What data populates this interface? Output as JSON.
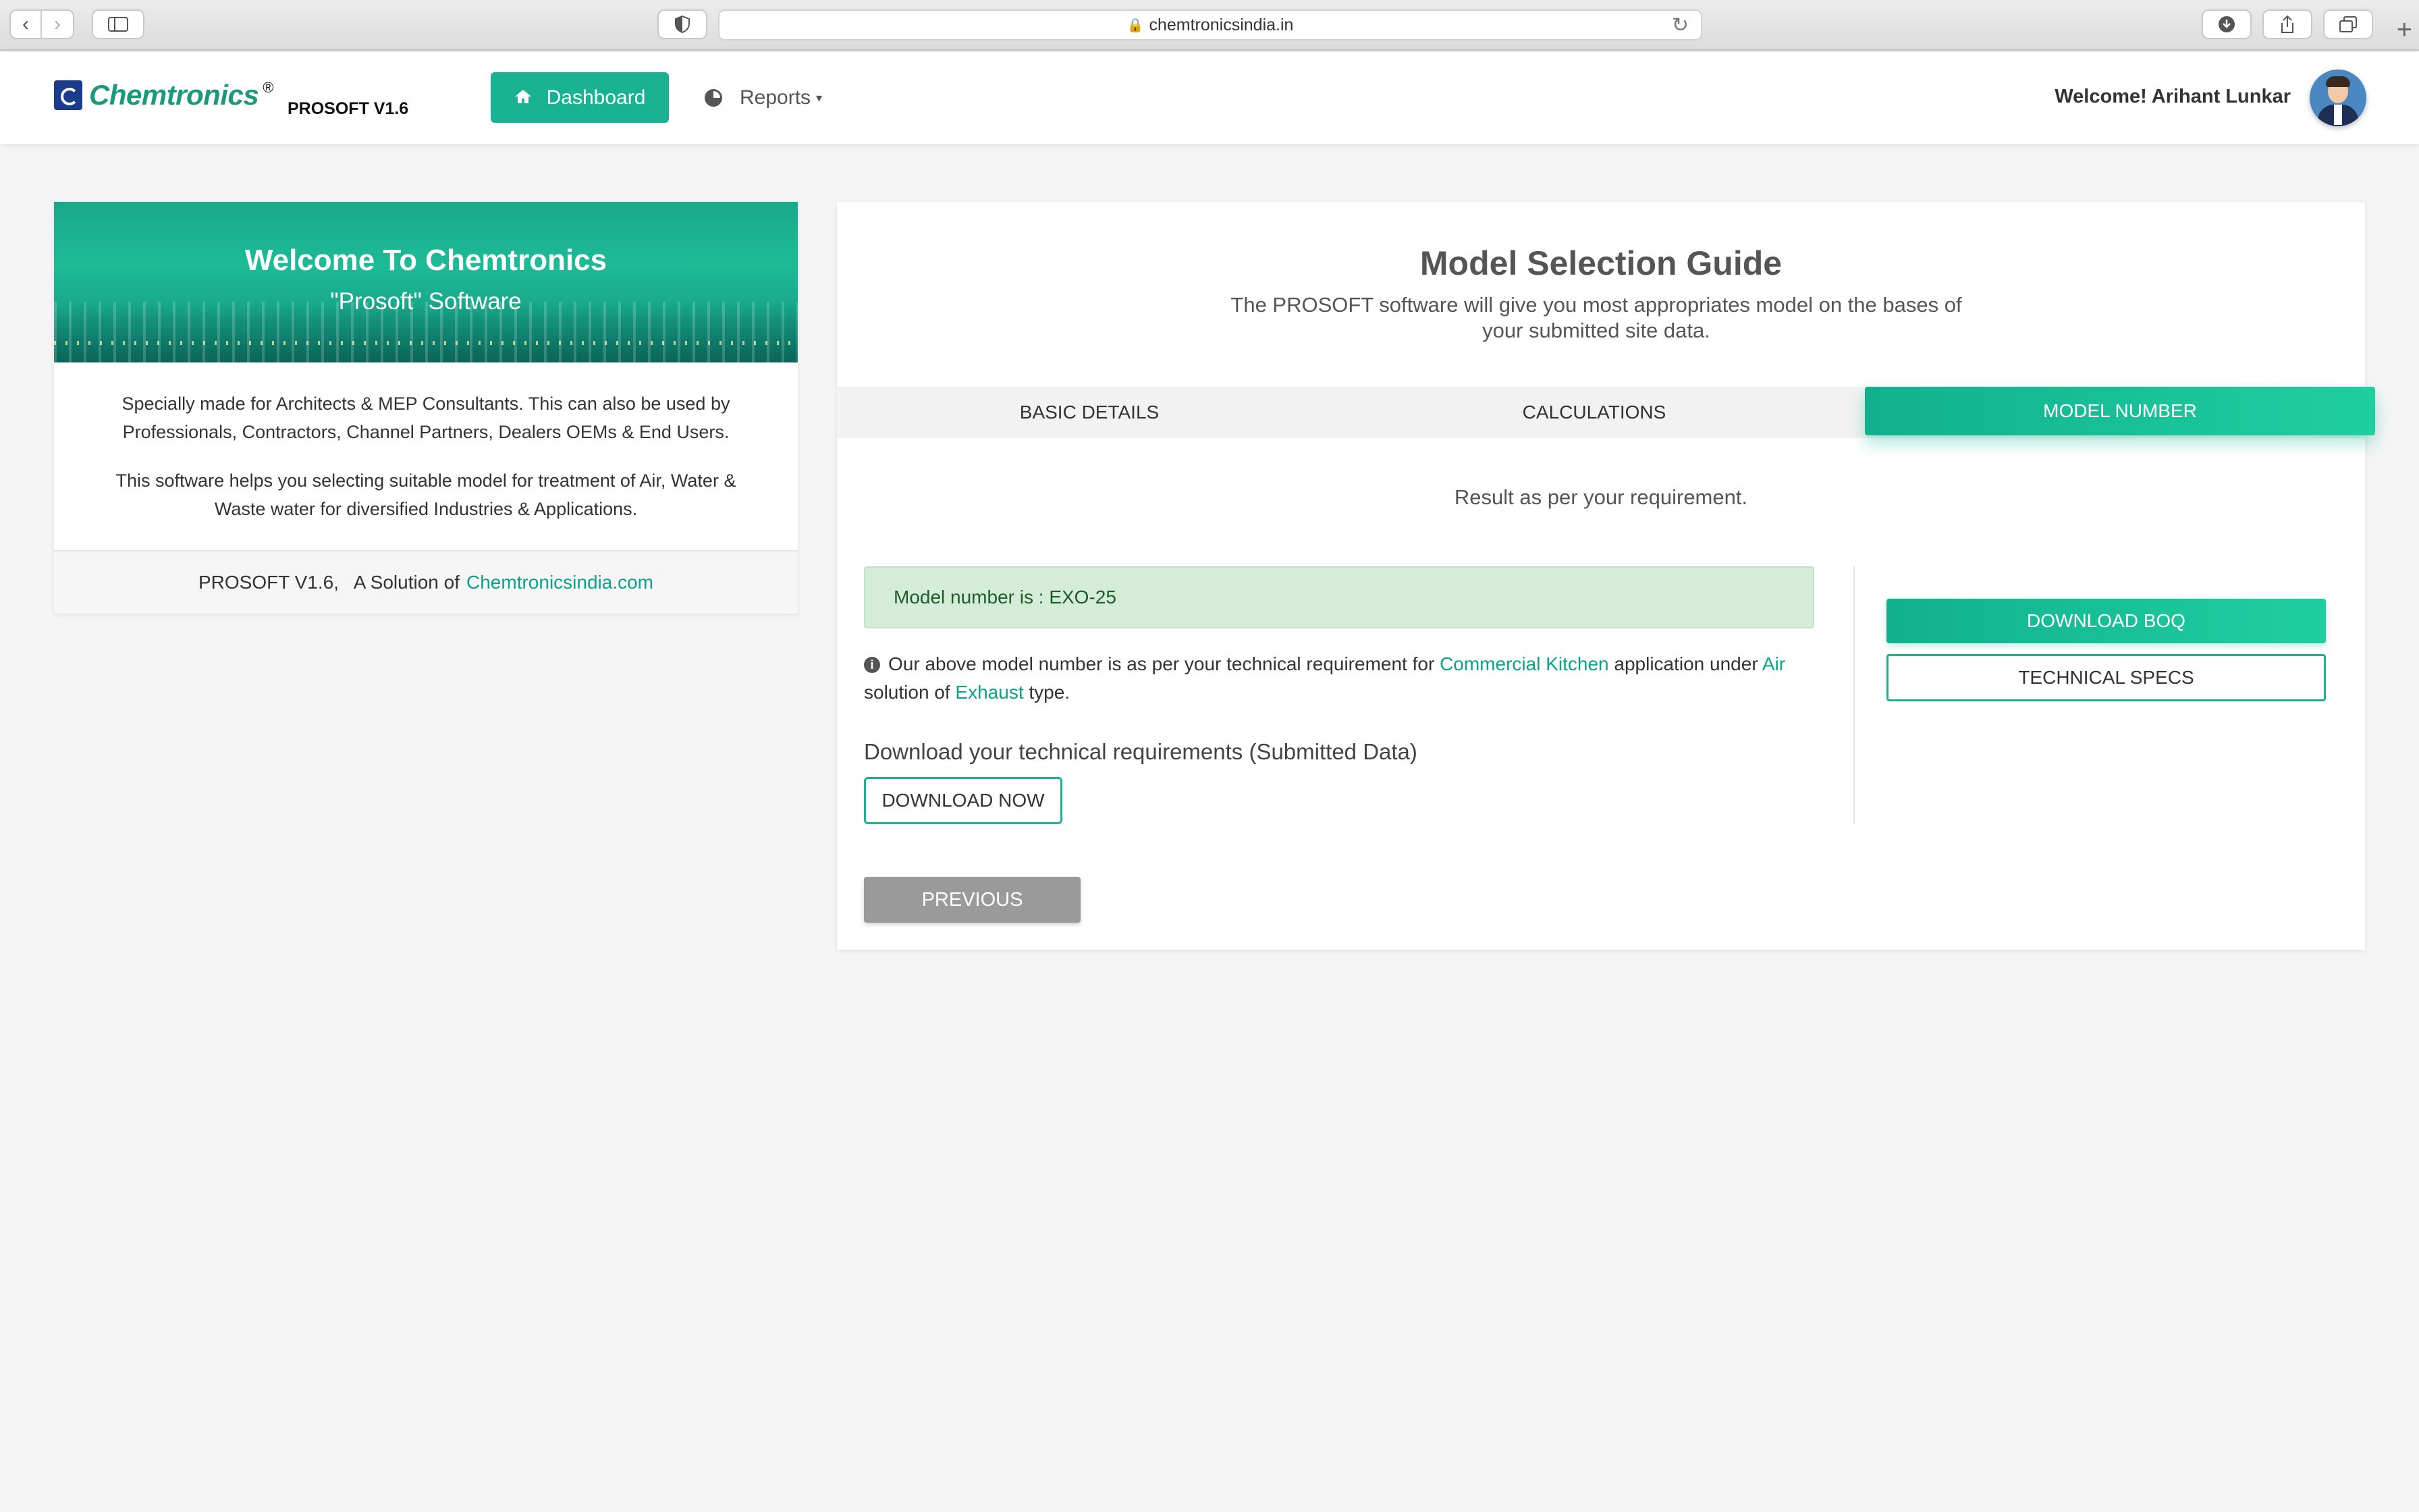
{
  "browser": {
    "url": "chemtronicsindia.in",
    "back_icon": "chevron-left",
    "forward_icon": "chevron-right",
    "new_tab_symbol": "+"
  },
  "header": {
    "brand": "Chemtronics",
    "registered": "®",
    "version": "PROSOFT V1.6",
    "dashboard_label": "Dashboard",
    "reports_label": "Reports",
    "welcome_text": "Welcome! Arihant Lunkar"
  },
  "welcome_card": {
    "title": "Welcome To Chemtronics",
    "subtitle": "\"Prosoft\" Software",
    "paragraph1": "Specially made for Architects & MEP Consultants. This can also be used by Professionals, Contractors, Channel Partners, Dealers OEMs & End Users.",
    "paragraph2": "This software helps you selecting suitable model for treatment of Air, Water & Waste water for diversified Industries & Applications.",
    "footer_prefix": "PROSOFT V1.6,   A Solution of",
    "footer_link": "Chemtronicsindia.com"
  },
  "guide": {
    "title": "Model Selection Guide",
    "subtitle": "The PROSOFT software will give you most appropriates model on the bases of your submitted site data.",
    "tabs": [
      {
        "label": "Basic Details",
        "active": false
      },
      {
        "label": "Calculations",
        "active": false
      },
      {
        "label": "Model Number",
        "active": true
      }
    ],
    "result_text": "Result as per your requirement.",
    "model_alert": "Model number is : EXO-25",
    "note": {
      "part1": "Our above model number is as per your technical requirement for",
      "application": "Commercial Kitchen",
      "part2": "application under",
      "solution": "Air",
      "part3": "solution of",
      "type": "Exhaust",
      "part4": "type."
    },
    "download_label": "Download your technical requirements (Submitted Data)",
    "download_now": "DOWNLOAD NOW",
    "download_boq": "DOWNLOAD BOQ",
    "technical_specs": "TECHNICAL SPECS",
    "previous": "PREVIOUS"
  },
  "colors": {
    "accent": "#19b394",
    "link": "#0aa38a",
    "alert_bg": "#d4ecd8",
    "previous_bg": "#9a9a9a"
  }
}
